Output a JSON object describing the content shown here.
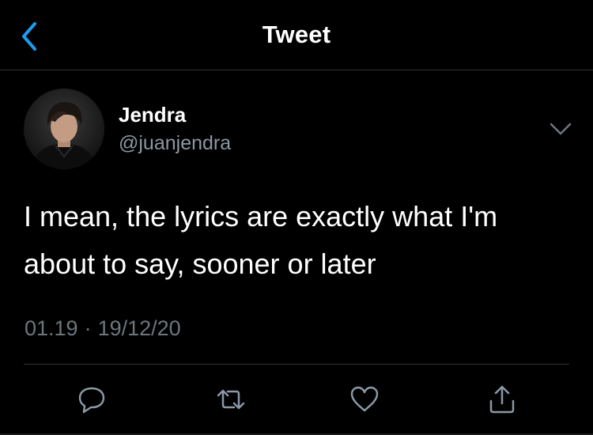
{
  "header": {
    "title": "Tweet",
    "back_icon": "chevron-left-icon",
    "accent_color": "#1d9bf0"
  },
  "tweet": {
    "author": {
      "display_name": "Jendra",
      "handle": "@juanjendra",
      "avatar": "avatar-photo"
    },
    "menu_icon": "chevron-down-icon",
    "text_lines": [
      "I mean, the lyrics are exactly what I'm",
      "about to say, sooner or later"
    ],
    "time": "01.19",
    "separator": "·",
    "date": "19/12/20"
  },
  "actions": [
    {
      "name": "reply",
      "icon": "reply-icon"
    },
    {
      "name": "retweet",
      "icon": "retweet-icon"
    },
    {
      "name": "like",
      "icon": "heart-icon"
    },
    {
      "name": "share",
      "icon": "share-icon"
    }
  ],
  "colors": {
    "background": "#000000",
    "text": "#ffffff",
    "secondary_text": "#8b98a5",
    "divider": "#2f3336"
  }
}
